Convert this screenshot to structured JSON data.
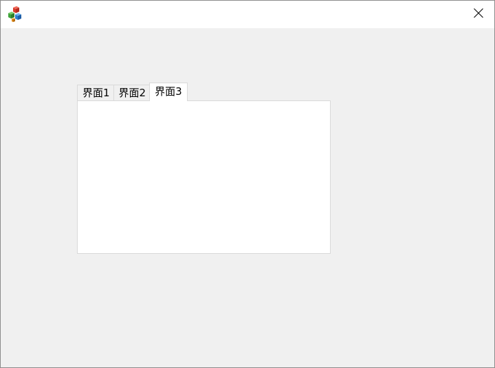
{
  "window": {
    "icon": "app-cubes-icon",
    "close_icon": "close-icon"
  },
  "tabs": [
    {
      "label": "界面1",
      "active": false
    },
    {
      "label": "界面2",
      "active": false
    },
    {
      "label": "界面3",
      "active": true
    }
  ],
  "colors": {
    "client_background": "#f0f0f0",
    "titlebar_background": "#ffffff",
    "tab_border": "#d9d9d9",
    "panel_background": "#ffffff"
  }
}
